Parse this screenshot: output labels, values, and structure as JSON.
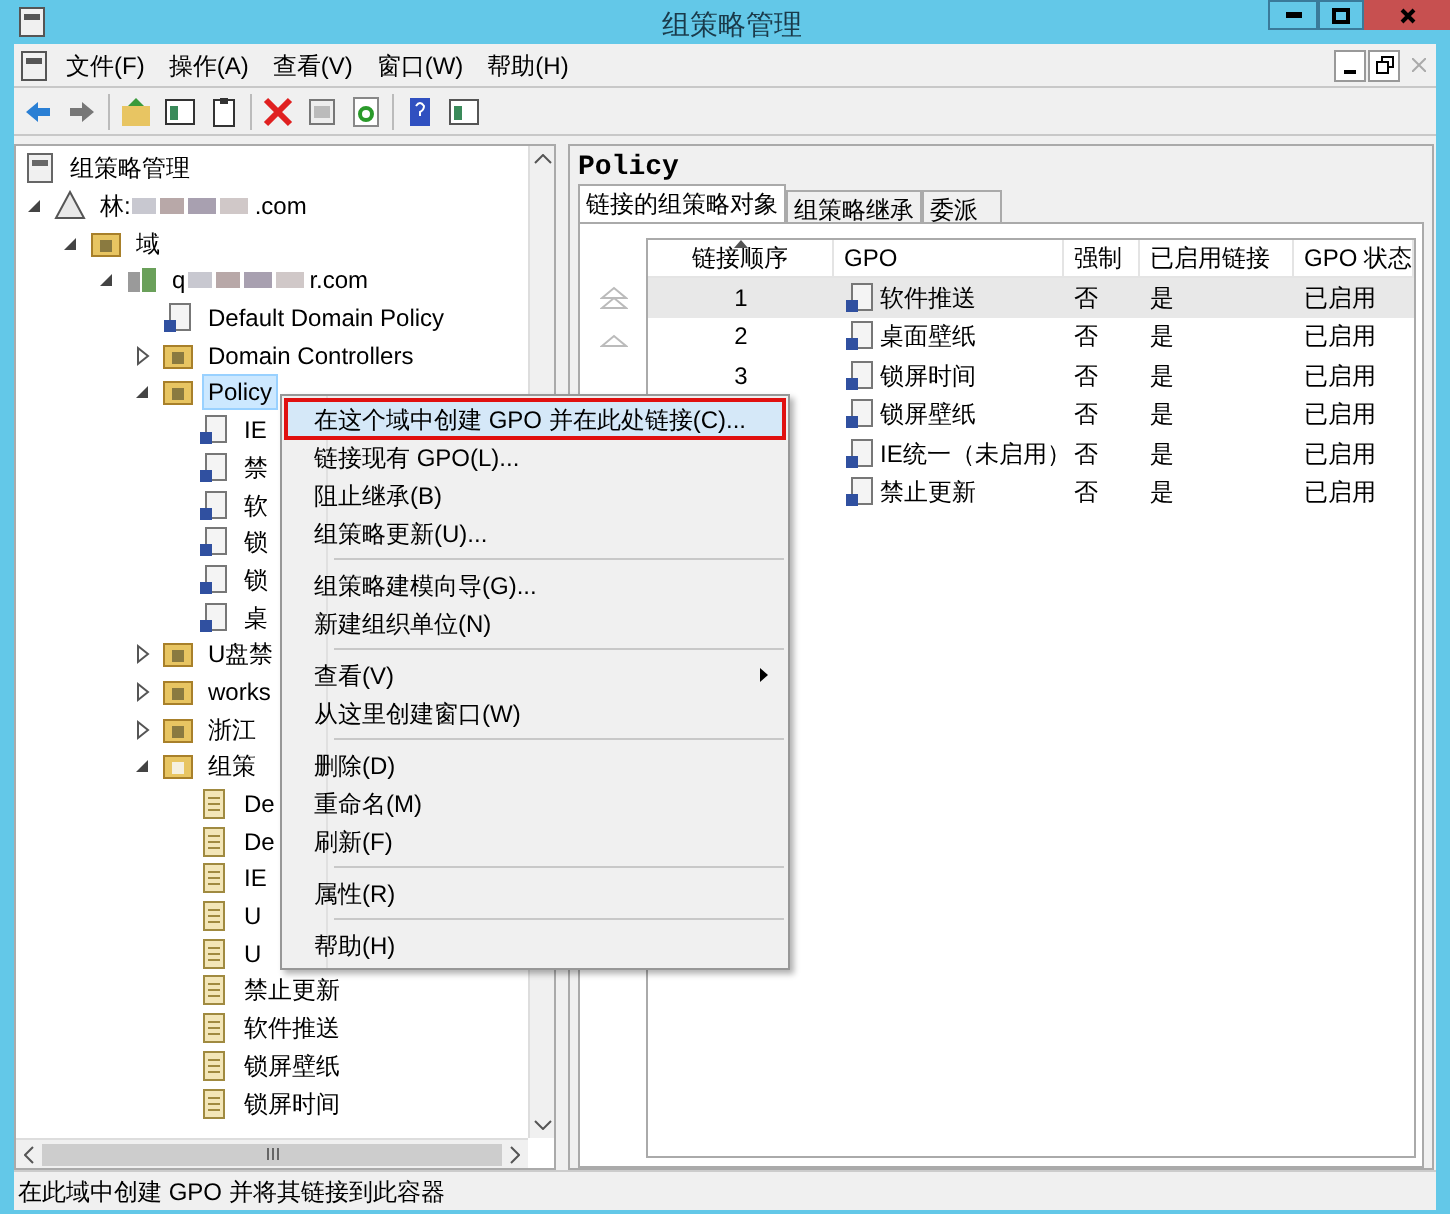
{
  "window": {
    "title": "组策略管理"
  },
  "menu_bar": [
    "文件(F)",
    "操作(A)",
    "查看(V)",
    "窗口(W)",
    "帮助(H)"
  ],
  "tree": [
    {
      "label": "组策略管理",
      "kind": "manager",
      "children": [
        {
          "label": "林: ",
          "tail": ".com",
          "kind": "forest",
          "expanded": true,
          "children": [
            {
              "label": "域",
              "kind": "domains",
              "expanded": true,
              "children": [
                {
                  "label": "q",
                  "tail": "r.com",
                  "kind": "domain",
                  "expanded": true,
                  "children": [
                    {
                      "label": "Default Domain Policy",
                      "kind": "gpo-link",
                      "selected": false
                    },
                    {
                      "label": "Domain Controllers",
                      "kind": "ou",
                      "expanded": false,
                      "selected": false
                    },
                    {
                      "label": "Policy",
                      "kind": "ou",
                      "expanded": true,
                      "selected": true,
                      "children": [
                        {
                          "label": "IE",
                          "kind": "gpo-link",
                          "selected": false
                        },
                        {
                          "label": "禁",
                          "kind": "gpo-link",
                          "selected": false
                        },
                        {
                          "label": "软",
                          "kind": "gpo-link",
                          "selected": false
                        },
                        {
                          "label": "锁",
                          "kind": "gpo-link",
                          "selected": false
                        },
                        {
                          "label": "锁",
                          "kind": "gpo-link",
                          "selected": false
                        },
                        {
                          "label": "桌",
                          "kind": "gpo-link",
                          "selected": false
                        }
                      ]
                    },
                    {
                      "label": "U盘禁",
                      "kind": "ou",
                      "expanded": false,
                      "selected": false
                    },
                    {
                      "label": "works",
                      "kind": "ou",
                      "expanded": false,
                      "selected": false
                    },
                    {
                      "label": "浙江",
                      "kind": "ou",
                      "expanded": false,
                      "selected": false
                    },
                    {
                      "label": "组策",
                      "kind": "gpo-folder",
                      "expanded": true,
                      "selected": false,
                      "children": [
                        {
                          "label": "De",
                          "kind": "gpo",
                          "selected": false
                        },
                        {
                          "label": "De",
                          "kind": "gpo",
                          "selected": false
                        },
                        {
                          "label": "IE",
                          "kind": "gpo",
                          "selected": false
                        },
                        {
                          "label": "U",
                          "kind": "gpo",
                          "selected": false
                        },
                        {
                          "label": "U",
                          "kind": "gpo",
                          "selected": false
                        },
                        {
                          "label": "禁止更新",
                          "kind": "gpo",
                          "selected": false
                        },
                        {
                          "label": "软件推送",
                          "kind": "gpo",
                          "selected": false
                        },
                        {
                          "label": "锁屏壁纸",
                          "kind": "gpo",
                          "selected": false
                        },
                        {
                          "label": "锁屏时间",
                          "kind": "gpo",
                          "selected": false
                        }
                      ]
                    }
                  ]
                }
              ]
            }
          ]
        }
      ]
    }
  ],
  "context_menu": [
    {
      "kind": "item",
      "label": "在这个域中创建 GPO 并在此处链接(C)...",
      "selected": true
    },
    {
      "kind": "item",
      "label": "链接现有 GPO(L)...",
      "selected": false
    },
    {
      "kind": "item",
      "label": "阻止继承(B)",
      "selected": false
    },
    {
      "kind": "item",
      "label": "组策略更新(U)...",
      "selected": false
    },
    {
      "kind": "separator"
    },
    {
      "kind": "item",
      "label": "组策略建模向导(G)...",
      "selected": false
    },
    {
      "kind": "item",
      "label": "新建组织单位(N)",
      "selected": false
    },
    {
      "kind": "separator"
    },
    {
      "kind": "submenu",
      "label": "查看(V)",
      "selected": false
    },
    {
      "kind": "item",
      "label": "从这里创建窗口(W)",
      "selected": false
    },
    {
      "kind": "separator"
    },
    {
      "kind": "item",
      "label": "删除(D)",
      "selected": false
    },
    {
      "kind": "item",
      "label": "重命名(M)",
      "selected": false
    },
    {
      "kind": "item",
      "label": "刷新(F)",
      "selected": false
    },
    {
      "kind": "separator"
    },
    {
      "kind": "item",
      "label": "属性(R)",
      "selected": false
    },
    {
      "kind": "separator"
    },
    {
      "kind": "item",
      "label": "帮助(H)",
      "selected": false
    }
  ],
  "details": {
    "title": "Policy",
    "tabs": [
      {
        "label": "链接的组策略对象",
        "selected": true
      },
      {
        "label": "组策略继承",
        "selected": false
      },
      {
        "label": "委派",
        "selected": false
      }
    ],
    "table": {
      "columns": [
        "链接顺序",
        "GPO",
        "强制",
        "已启用链接",
        "GPO 状态"
      ],
      "rows": [
        {
          "order": "1",
          "gpo": "软件推送",
          "enforced": "否",
          "link_enabled": "是",
          "status": "已启用",
          "selected": true
        },
        {
          "order": "2",
          "gpo": "桌面壁纸",
          "enforced": "否",
          "link_enabled": "是",
          "status": "已启用",
          "selected": false
        },
        {
          "order": "3",
          "gpo": "锁屏时间",
          "enforced": "否",
          "link_enabled": "是",
          "status": "已启用",
          "selected": false
        },
        {
          "gpo": "锁屏壁纸",
          "enforced": "否",
          "link_enabled": "是",
          "status": "已启用",
          "selected": false
        },
        {
          "gpo": "IE统一（未启用）",
          "enforced": "否",
          "link_enabled": "是",
          "status": "已启用",
          "selected": false
        },
        {
          "gpo": "禁止更新",
          "enforced": "否",
          "link_enabled": "是",
          "status": "已启用",
          "selected": false
        }
      ]
    }
  },
  "status_bar": "在此域中创建 GPO 并将其链接到此容器"
}
